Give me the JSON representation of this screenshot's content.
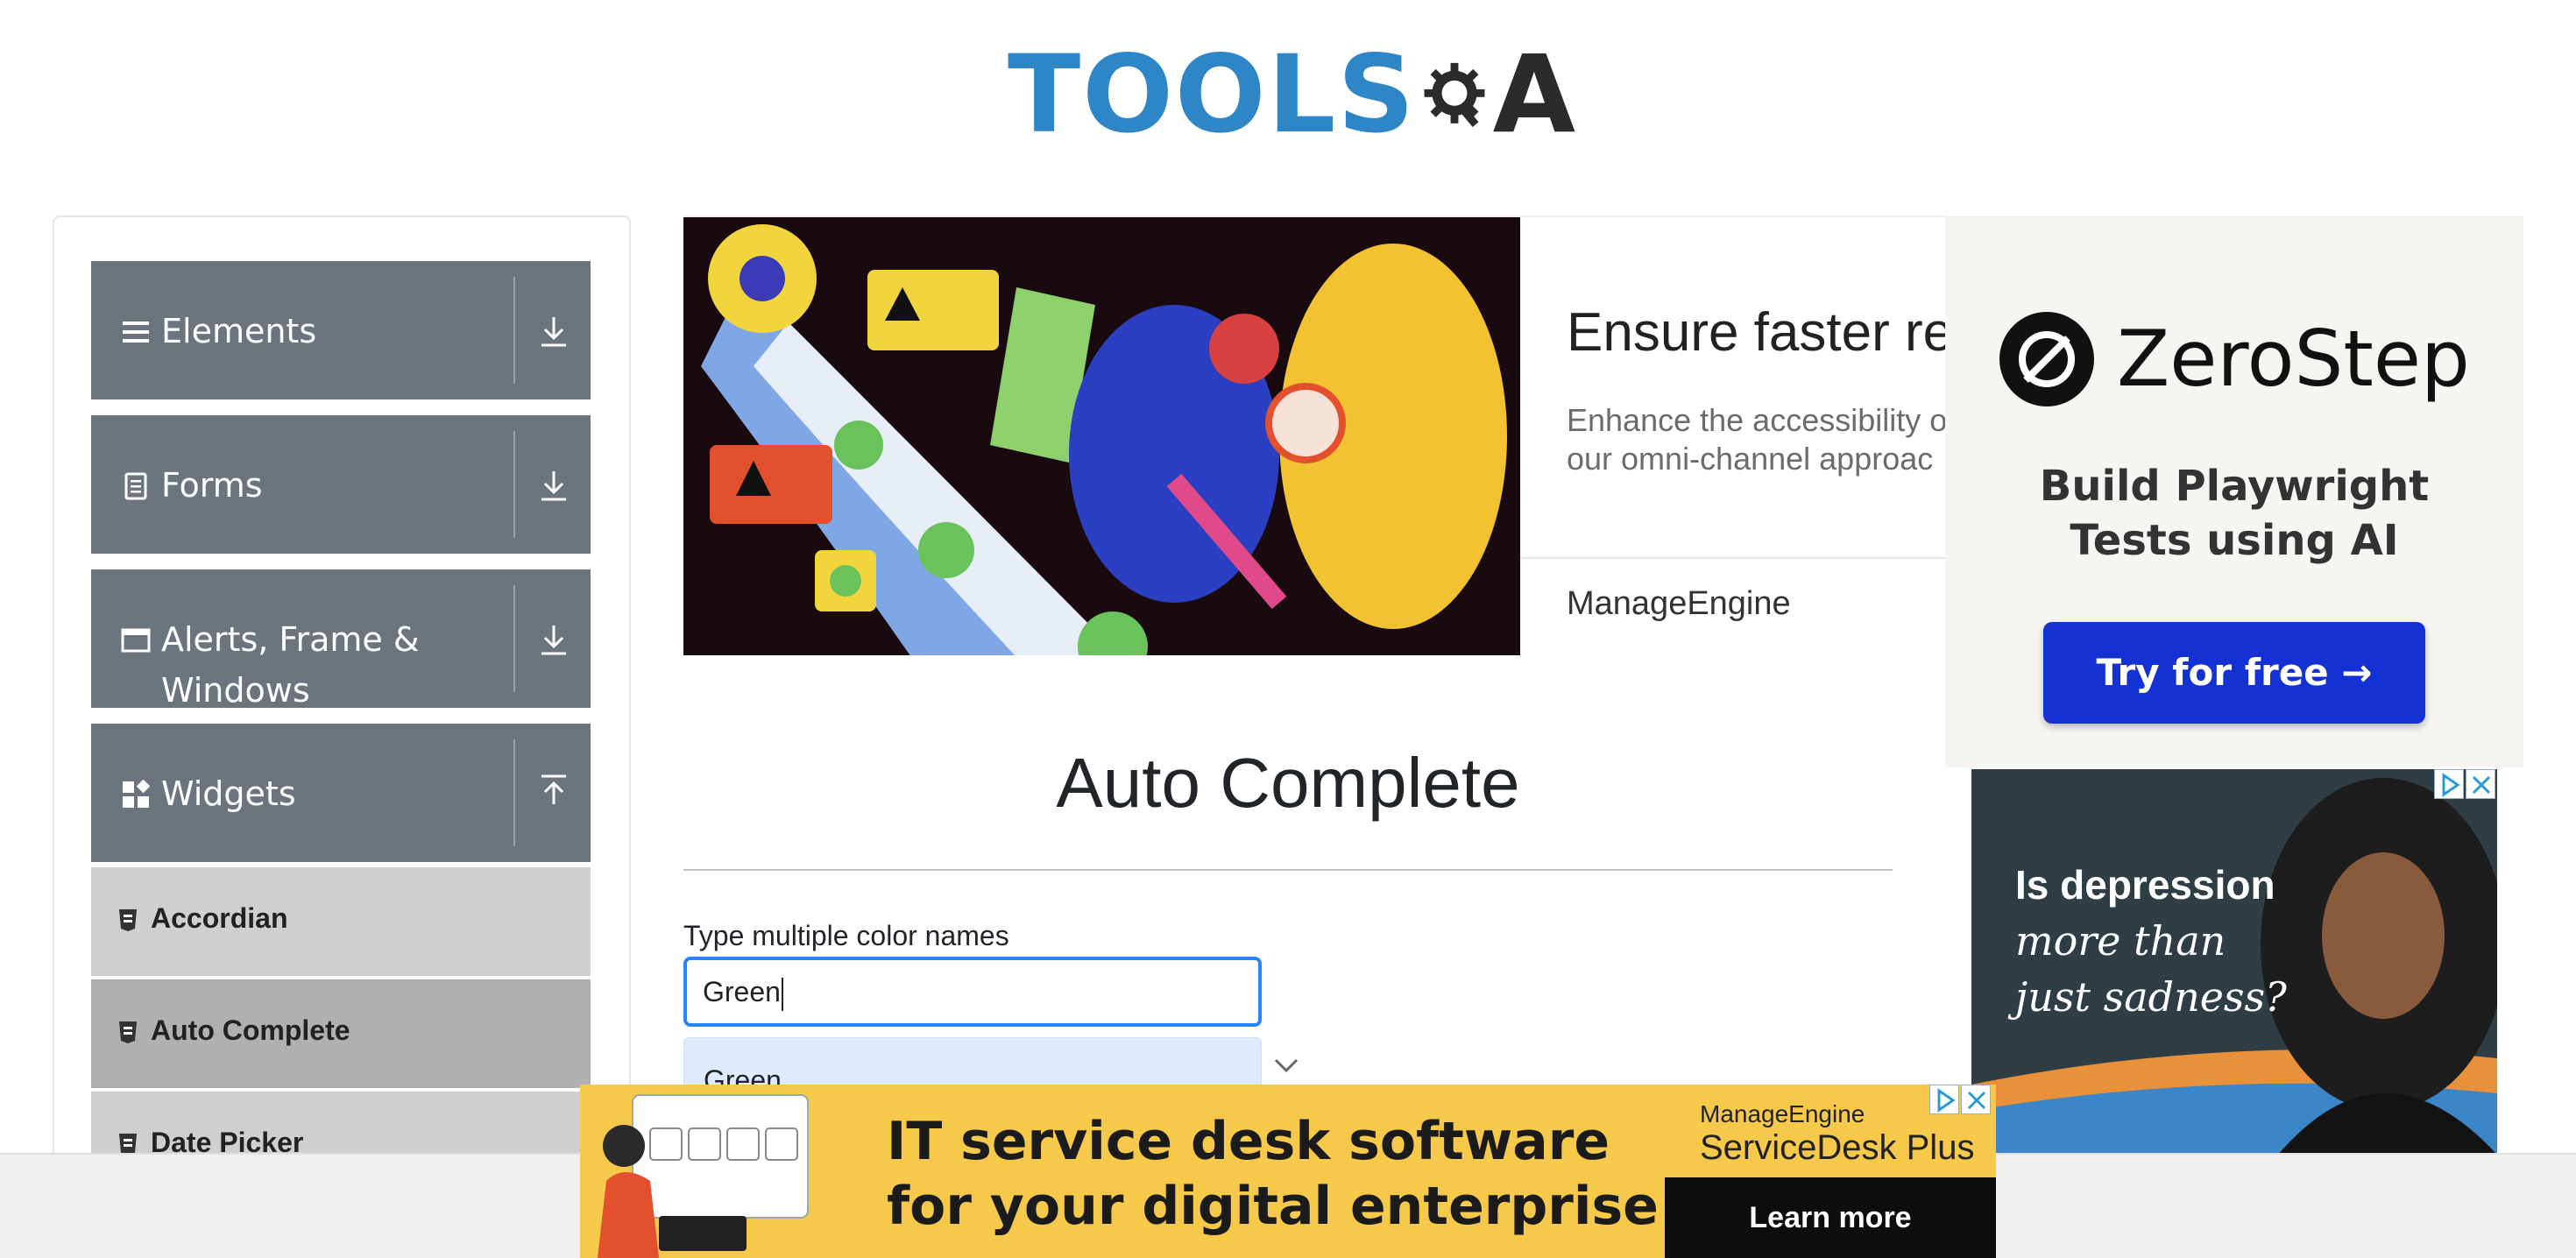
{
  "header": {
    "logo_text_tools": "TOOLS",
    "logo_text_qa": "QA"
  },
  "sidebar": {
    "groups": [
      {
        "label": "Elements",
        "icon": "hamburger-icon",
        "expanded": false
      },
      {
        "label": "Forms",
        "icon": "document-icon",
        "expanded": false
      },
      {
        "label": "Alerts, Frame &",
        "label2": "Windows",
        "icon": "window-icon",
        "expanded": false
      },
      {
        "label": "Widgets",
        "icon": "widgets-icon",
        "expanded": true
      }
    ],
    "items": [
      {
        "label": "Accordian",
        "active": false
      },
      {
        "label": "Auto Complete",
        "active": true
      },
      {
        "label": "Date Picker",
        "active": false
      }
    ]
  },
  "banner_ad": {
    "title": "Ensure faster res",
    "description_line1": "Enhance the accessibility o",
    "description_line2": "our omni-channel approac",
    "brand": "ManageEngine"
  },
  "right_ad": {
    "brand": "ZeroStep",
    "tagline_line1": "Build Playwright",
    "tagline_line2": "Tests using AI",
    "cta": "Try for free →"
  },
  "depression_ad": {
    "line1": "Is depression",
    "line2": "more than",
    "line3": "just sadness?"
  },
  "main": {
    "title": "Auto Complete",
    "multi_label": "Type multiple color names",
    "multi_value": "Green",
    "suggestion": "Green"
  },
  "bottom_ad": {
    "headline_line1": "IT service desk software",
    "headline_line2": "for your digital enterprise",
    "brand_small": "ManageEngine",
    "brand_product": "ServiceDesk Plus",
    "cta": "Learn more"
  },
  "colors": {
    "sidebar_header": "#6c757d",
    "sidebar_item_active": "#b0b0b0",
    "sidebar_item": "#cfcfcf",
    "input_focus": "#2684ff",
    "suggestion_highlight": "#deebff",
    "zerostep_button": "#1431d4",
    "bottom_ad_bg": "#f7c94b"
  }
}
